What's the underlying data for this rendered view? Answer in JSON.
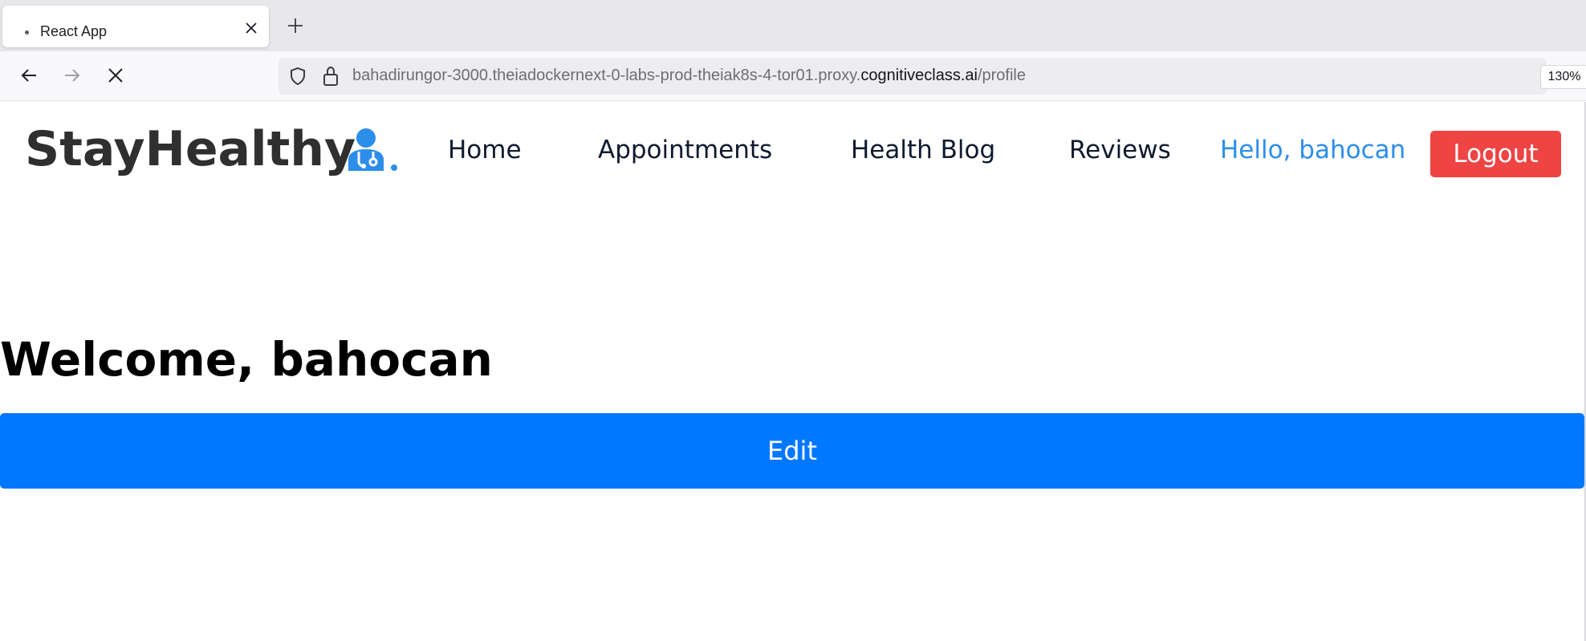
{
  "browser": {
    "tab": {
      "title": "React App"
    },
    "url": {
      "prefix": "bahadirungor-3000.theiadockernext-0-labs-prod-theiak8s-4-tor01.proxy.",
      "domain": "cognitiveclass.ai",
      "path": "/profile"
    },
    "zoom": "130%"
  },
  "app": {
    "brand": "StayHealthy",
    "nav": {
      "home": "Home",
      "appointments": "Appointments",
      "health_blog": "Health Blog",
      "reviews": "Reviews"
    },
    "greeting": "Hello, bahocan",
    "logout_label": "Logout"
  },
  "main": {
    "welcome": "Welcome, bahocan",
    "edit_label": "Edit"
  },
  "colors": {
    "accent": "#0077ff",
    "logout": "#ef4444",
    "greeting": "#2d8eea",
    "brand_text": "#2f2f2f"
  }
}
